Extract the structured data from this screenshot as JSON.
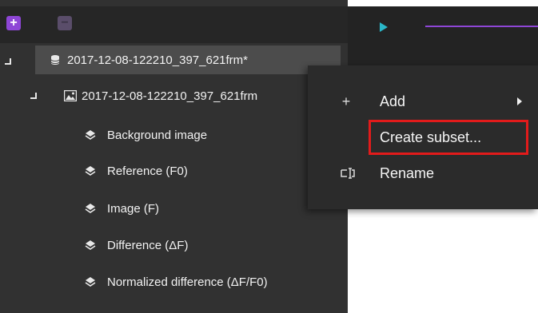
{
  "toolbar": {
    "add_icon": "plus-icon",
    "remove_icon": "minus-icon"
  },
  "tree": {
    "root": {
      "label": "2017-12-08-122210_397_621frm*",
      "icon": "database-icon"
    },
    "child": {
      "label": "2017-12-08-122210_397_621frm",
      "icon": "image-icon"
    },
    "layers": [
      {
        "label": "Background image",
        "icon": "layers-icon"
      },
      {
        "label": "Reference (F0)",
        "icon": "layers-icon"
      },
      {
        "label": "Image (F)",
        "icon": "layers-icon"
      },
      {
        "label": "Difference (ΔF)",
        "icon": "layers-icon"
      },
      {
        "label": "Normalized difference (ΔF/F0)",
        "icon": "layers-icon"
      }
    ]
  },
  "context_menu": {
    "items": [
      {
        "label": "Add",
        "icon": "plus-icon",
        "has_submenu": true
      },
      {
        "label": "Create subset...",
        "icon": "",
        "highlighted": true
      },
      {
        "label": "Rename",
        "icon": "rename-icon"
      }
    ]
  },
  "colors": {
    "accent": "#8e46d6",
    "play": "#2ab7c8",
    "highlight": "#e21b1b",
    "panel": "#313131",
    "menu": "#2b2b2b"
  }
}
